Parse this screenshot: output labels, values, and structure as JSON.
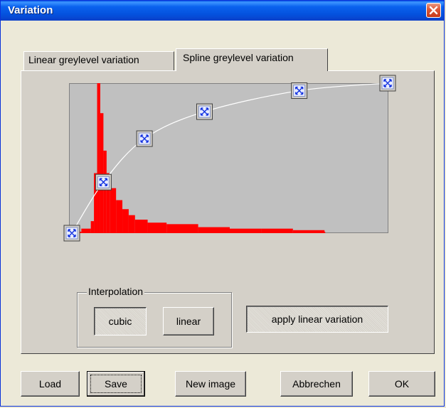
{
  "window": {
    "title": "Variation",
    "close_icon": "close-icon"
  },
  "tabs": [
    {
      "label": "Linear greylevel variation",
      "active": false
    },
    {
      "label": "Spline greylevel variation",
      "active": true
    }
  ],
  "interpolation": {
    "group_label": "Interpolation",
    "cubic_label": "cubic",
    "linear_label": "linear",
    "selected": "cubic"
  },
  "apply_button_label": "apply linear variation",
  "footer": {
    "load_label": "Load",
    "save_label": "Save",
    "new_image_label": "New image",
    "cancel_label": "Abbrechen",
    "ok_label": "OK"
  },
  "colors": {
    "histogram": "#ff0000",
    "curve": "#ffffff",
    "plot_background": "#c0c0c0",
    "handle_icon": "#1030e0"
  },
  "chart_data": {
    "type": "area",
    "description_role": "greylevel histogram with spline transfer curve",
    "control_points": [
      {
        "x": 0,
        "y": 0
      },
      {
        "x": 10,
        "y": 34
      },
      {
        "x": 23,
        "y": 63
      },
      {
        "x": 42,
        "y": 81
      },
      {
        "x": 72,
        "y": 95
      },
      {
        "x": 100,
        "y": 100
      }
    ],
    "histogram": {
      "x": [
        0,
        3,
        6,
        7,
        8,
        9,
        10,
        11,
        12,
        14,
        16,
        18,
        20,
        24,
        30,
        40,
        50,
        60,
        70,
        80
      ],
      "values": [
        1,
        3,
        8,
        40,
        100,
        80,
        55,
        40,
        30,
        22,
        16,
        12,
        9,
        7,
        6,
        4,
        3,
        3,
        2,
        1
      ]
    },
    "xlim": [
      0,
      100
    ],
    "ylim": [
      0,
      100
    ]
  }
}
